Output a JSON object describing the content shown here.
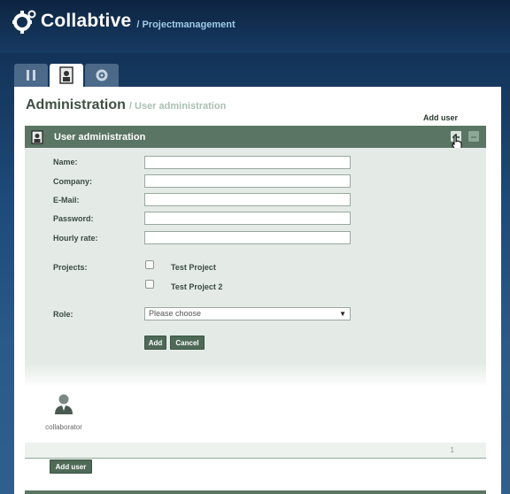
{
  "app": {
    "title": "Collabtive",
    "subtitle": "/ Projectmanagement"
  },
  "tabs": [
    {
      "icon": "tools-icon",
      "active": false
    },
    {
      "icon": "user-badge-icon",
      "active": true
    },
    {
      "icon": "gear-icon",
      "active": false
    }
  ],
  "page": {
    "heading": "Administration",
    "subheading": "/ User administration",
    "add_user_link": "Add user"
  },
  "block": {
    "title": "User administration"
  },
  "form": {
    "name_label": "Name:",
    "company_label": "Company:",
    "email_label": "E-Mail:",
    "password_label": "Password:",
    "rate_label": "Hourly rate:",
    "name_value": "",
    "company_value": "",
    "email_value": "",
    "password_value": "",
    "rate_value": "",
    "projects_label": "Projects:",
    "projects": [
      {
        "label": "Test Project",
        "checked": false
      },
      {
        "label": "Test Project 2",
        "checked": false
      }
    ],
    "role_label": "Role:",
    "role_selected": "Please choose",
    "add_button": "Add",
    "cancel_button": "Cancel"
  },
  "users": [
    {
      "name": "collaborator"
    }
  ],
  "pager": {
    "current_page": "1"
  },
  "footer": {
    "add_user_button": "Add user"
  },
  "colors": {
    "header_bg": "#5a7563",
    "form_bg": "#e4ebe6",
    "button_bg": "#4e6a57"
  }
}
